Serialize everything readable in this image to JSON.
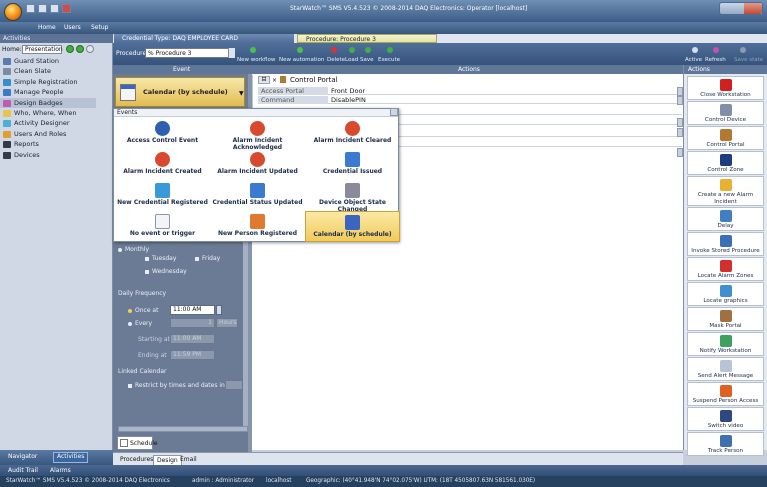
{
  "window": {
    "title": "StarWatch™ SMS V5.4.523 © 2008-2014 DAQ Electronics: Operator  [localhost]"
  },
  "menu": {
    "home": "Home",
    "users": "Users",
    "setup": "Setup"
  },
  "left": {
    "header": "Activities",
    "home_label": "Home:",
    "home_select": "Presentation",
    "items": [
      {
        "label": "Guard Station",
        "color": "#5a7bb0"
      },
      {
        "label": "Clean Slate",
        "color": "#7d8ca3"
      },
      {
        "label": "Simple Registration",
        "color": "#3a8ec8"
      },
      {
        "label": "Manage People",
        "color": "#3a7cc0"
      },
      {
        "label": "Design Badges",
        "color": "#c25bb0"
      },
      {
        "label": "Who, Where, When",
        "color": "#e8c44a"
      },
      {
        "label": "Activity Designer",
        "color": "#4ab0d8"
      },
      {
        "label": "Users And Roles",
        "color": "#e0a030"
      },
      {
        "label": "Reports",
        "color": "#333a48"
      },
      {
        "label": "Devices",
        "color": "#333a48"
      }
    ],
    "active_index": 4,
    "bottom": {
      "navigator": "Navigator",
      "activities": "Activities"
    }
  },
  "tabs": [
    {
      "label": "Credential Type: DAQ EMPLOYEE CARD"
    },
    {
      "label": "Procedure: Procedure 3"
    }
  ],
  "toolbar": {
    "procedure_label": "Procedure:",
    "procedure_value": "% Procedure 3",
    "buttons": [
      {
        "label": "New workflow",
        "color": "#4cc04c"
      },
      {
        "label": "New automation",
        "color": "#4cc04c"
      },
      {
        "label": "Delete",
        "color": "#e03030"
      },
      {
        "label": "Load",
        "color": "#40b040"
      },
      {
        "label": "Save",
        "color": "#40b040"
      },
      {
        "label": "Execute",
        "color": "#40b040"
      }
    ],
    "right": {
      "active": "Active",
      "refresh": "Refresh",
      "save_state": "Save state"
    }
  },
  "columns": {
    "event": "Event",
    "actions": "Actions",
    "actions_panel": "Actions"
  },
  "event_selected": "Calendar (by schedule)",
  "action_card": {
    "title": "Control Portal",
    "rows": [
      {
        "label": "Access Portal",
        "value": "Front Door"
      },
      {
        "label": "Command",
        "value": "DisablePIN"
      }
    ]
  },
  "popup": {
    "header": "Events",
    "events": [
      {
        "label": "Access Control Event",
        "icon": "access-control-icon"
      },
      {
        "label": "Alarm Incident Acknowledged",
        "icon": "alarm-clock-icon"
      },
      {
        "label": "Alarm Incident Cleared",
        "icon": "alarm-clock-icon"
      },
      {
        "label": "Alarm Incident Created",
        "icon": "alarm-clock-icon"
      },
      {
        "label": "Alarm Incident Updated",
        "icon": "alarm-clock-icon"
      },
      {
        "label": "Credential Issued",
        "icon": "credential-check-icon"
      },
      {
        "label": "New Credential Registered",
        "icon": "credential-card-icon"
      },
      {
        "label": "Credential Status Updated",
        "icon": "credential-edit-icon"
      },
      {
        "label": "Device Object State Changed",
        "icon": "gear-icon"
      },
      {
        "label": "No event or trigger",
        "icon": "blank-page-icon"
      },
      {
        "label": "New Person Registered",
        "icon": "person-icon"
      },
      {
        "label": "Calendar (by schedule)",
        "icon": "calendar-icon"
      }
    ],
    "selected_index": 11
  },
  "schedule": {
    "monthly": "Monthly",
    "tuesday": "Tuesday",
    "friday": "Friday",
    "wednesday": "Wednesday",
    "daily_frequency": "Daily Frequency",
    "once_at": "Once at",
    "once_value": "11:00 AM",
    "every": "Every",
    "every_value": "1",
    "every_unit": "Hours",
    "starting_at": "Starting at",
    "starting_value": "11:00 AM",
    "ending_at": "Ending at",
    "ending_value": "11:59 PM",
    "linked_calendar": "Linked Calendar",
    "restrict": "Restrict by times and dates in:",
    "tab": "Schedule"
  },
  "bottom_tabs": [
    "Procedures",
    "Design",
    "Email"
  ],
  "bottom_tab_active": 1,
  "actions": [
    {
      "label": "Close Workstation",
      "icon": "power-icon",
      "color": "#d02020"
    },
    {
      "label": "Control Device",
      "icon": "gear-icon",
      "color": "#8090a8"
    },
    {
      "label": "Control Portal",
      "icon": "door-icon",
      "color": "#b07a30"
    },
    {
      "label": "Control Zone",
      "icon": "zone-icon",
      "color": "#203c80"
    },
    {
      "label": "Create a new Alarm Incident",
      "icon": "alarm-bell-icon",
      "color": "#e8b030"
    },
    {
      "label": "Delay",
      "icon": "hourglass-icon",
      "color": "#4080c0"
    },
    {
      "label": "Invoke Stored Procedure",
      "icon": "procedure-icon",
      "color": "#3a70b8"
    },
    {
      "label": "Locate Alarm Zones",
      "icon": "map-pin-icon",
      "color": "#d03030"
    },
    {
      "label": "Locate graphics",
      "icon": "graphics-icon",
      "color": "#4090d0"
    },
    {
      "label": "Mask Portal",
      "icon": "mask-door-icon",
      "color": "#a07040"
    },
    {
      "label": "Notify Workstation",
      "icon": "notify-icon",
      "color": "#40a060"
    },
    {
      "label": "Send Alert Message",
      "icon": "envelope-icon",
      "color": "#b8c4d4"
    },
    {
      "label": "Suspend Person Access",
      "icon": "person-icon",
      "color": "#e06020"
    },
    {
      "label": "Switch video",
      "icon": "camera-icon",
      "color": "#304880"
    },
    {
      "label": "Track Person",
      "icon": "track-icon",
      "color": "#4070b0"
    }
  ],
  "status": {
    "audit": "Audit Trail",
    "alarms": "Alarms",
    "version": "StarWatch™ SMS V5.4.523 © 2008-2014 DAQ Electronics",
    "admin": "admin : Administrator",
    "host": "localhost",
    "geo": "Geographic: (40°41.948'N 74°02.075'W)   UTM: (18T 4505807.63N 581561.030E)"
  }
}
